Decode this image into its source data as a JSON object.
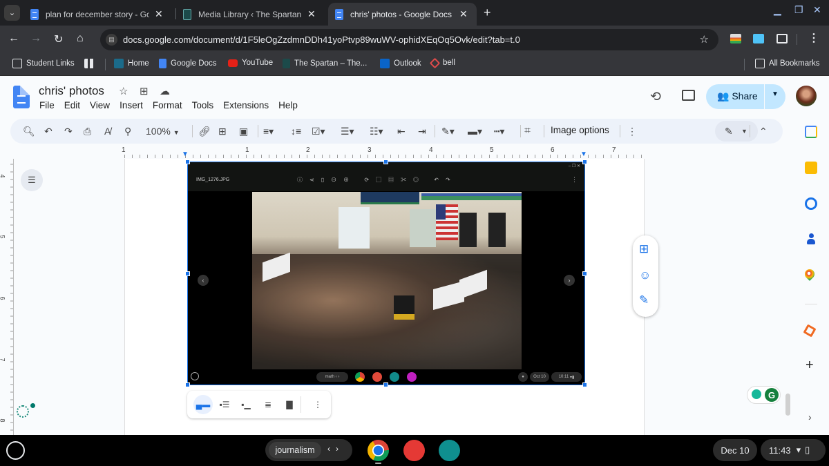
{
  "browser": {
    "tabs": [
      {
        "title": "plan for december story - Google Docs",
        "icon": "google-docs-icon",
        "active": false
      },
      {
        "title": "Media Library ‹ The Spartan — WordPress",
        "icon": "the-spartan-icon",
        "active": false
      },
      {
        "title": "chris' photos - Google Docs",
        "icon": "google-docs-icon",
        "active": true
      }
    ],
    "new_tab_label": "+",
    "url": "docs.google.com/document/d/1F5leOgZzdmnDDh41yoPtvp89wuWV-ophidXEqOq5Ovk/edit?tab=t.0",
    "bookmarks": [
      {
        "label": "Student Links",
        "icon": "folder-settings-icon"
      },
      {
        "label": "",
        "icon": "apps-grid-icon"
      },
      {
        "label": "Home",
        "icon": "p-logo-icon"
      },
      {
        "label": "Google Docs",
        "icon": "google-docs-icon"
      },
      {
        "label": "YouTube",
        "icon": "youtube-icon"
      },
      {
        "label": "The Spartan – The...",
        "icon": "the-spartan-icon"
      },
      {
        "label": "Outlook",
        "icon": "outlook-icon"
      },
      {
        "label": "bell",
        "icon": "bell-logo-icon"
      }
    ],
    "all_bookmarks_label": "All Bookmarks"
  },
  "docs": {
    "title": "chris' photos",
    "menu": [
      "File",
      "Edit",
      "View",
      "Insert",
      "Format",
      "Tools",
      "Extensions",
      "Help"
    ],
    "share_label": "Share",
    "zoom": "100%",
    "image_options_label": "Image options",
    "ruler_h": [
      "1",
      "1",
      "2",
      "3",
      "4",
      "5",
      "6",
      "7"
    ],
    "ruler_v": [
      "4",
      "5",
      "6",
      "7",
      "8"
    ]
  },
  "embedded_screenshot": {
    "filename": "IMG_1276.JPG",
    "desk_label": "math",
    "date": "Oct 10",
    "time": "10:11",
    "photo_description": "Band rehearsal in music room with American flag"
  },
  "shelf": {
    "desk_label": "journalism",
    "date": "Dec 10",
    "time": "11:43"
  },
  "colors": {
    "accent": "#1a73e8",
    "share_bg": "#c2e7ff",
    "chrome_dark": "#202124",
    "chrome_toolbar": "#35363a"
  }
}
